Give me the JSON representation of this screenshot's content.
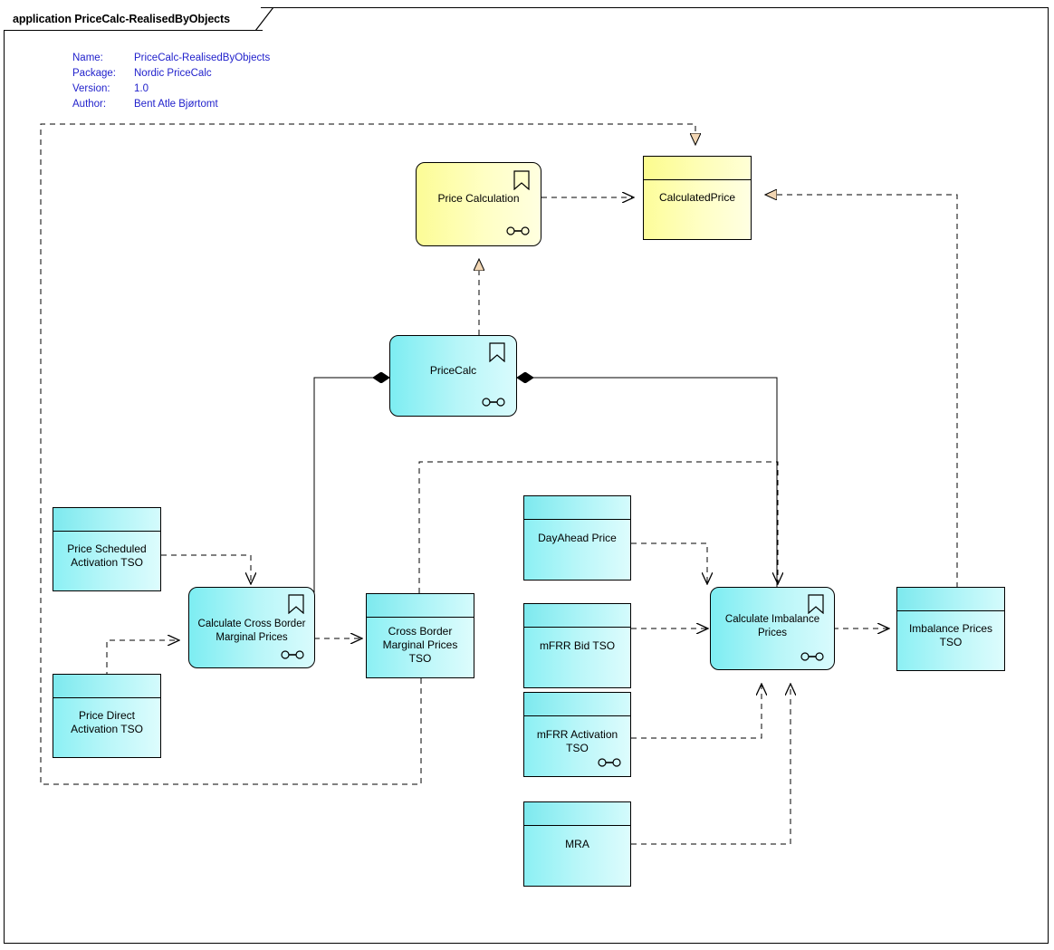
{
  "window": {
    "title_prefix": "application",
    "title": "application PriceCalc-RealisedByObjects"
  },
  "meta": {
    "rows": [
      {
        "key": "Name:",
        "value": "PriceCalc-RealisedByObjects"
      },
      {
        "key": "Package:",
        "value": "Nordic PriceCalc"
      },
      {
        "key": "Version:",
        "value": "1.0"
      },
      {
        "key": "Author:",
        "value": "Bent Atle Bjørtomt"
      }
    ]
  },
  "colors": {
    "yellow_fill": "#FFFFAA",
    "cyan_fill": "#AEF4F7",
    "arrow_fill": "#F2D6B3",
    "meta_text": "#2222CC",
    "stroke": "#000000"
  },
  "elements": {
    "price_calculation": {
      "label": "Price Calculation",
      "type": "component",
      "color": "yellow"
    },
    "calculated_price": {
      "label": "CalculatedPrice",
      "type": "data-object",
      "color": "yellow"
    },
    "price_calc": {
      "label": "PriceCalc",
      "type": "component",
      "color": "cyan"
    },
    "price_scheduled": {
      "label": "Price Scheduled\nActivation TSO",
      "type": "data-object",
      "color": "cyan"
    },
    "price_direct": {
      "label": "Price Direct\nActivation TSO",
      "type": "data-object",
      "color": "cyan"
    },
    "calc_cross_border": {
      "label": "Calculate Cross Border\nMarginal Prices",
      "type": "component",
      "color": "cyan"
    },
    "cross_border_tso": {
      "label": "Cross Border\nMarginal Prices\nTSO",
      "type": "data-object",
      "color": "cyan"
    },
    "dayahead_price": {
      "label": "DayAhead Price",
      "type": "data-object",
      "color": "cyan"
    },
    "mfrr_bid_tso": {
      "label": "mFRR Bid TSO",
      "type": "data-object",
      "color": "cyan"
    },
    "mfrr_activation_tso": {
      "label": "mFRR Activation\nTSO",
      "type": "data-object",
      "color": "cyan"
    },
    "mra": {
      "label": "MRA",
      "type": "data-object",
      "color": "cyan"
    },
    "calc_imbalance": {
      "label": "Calculate Imbalance\nPrices",
      "type": "component",
      "color": "cyan"
    },
    "imbalance_prices_tso": {
      "label": "Imbalance Prices\nTSO",
      "type": "data-object",
      "color": "cyan"
    }
  },
  "icons": {
    "bookmark": "bookmark-icon",
    "interface": "interface-connector-icon",
    "realization_arrow": "hollow-triangle-arrow",
    "composition_diamond": "filled-diamond",
    "dependency_arrow": "open-arrow-head"
  }
}
